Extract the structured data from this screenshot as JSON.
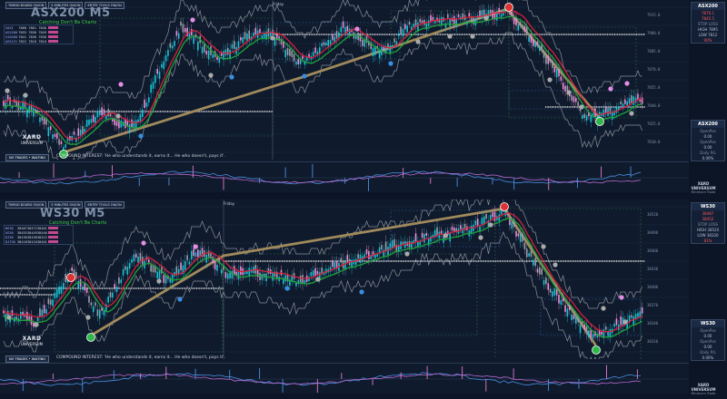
{
  "colors": {
    "bg": "#0f1a2c",
    "candle_up": "#19c2d6",
    "candle_down": "#ec8fd6",
    "ma_red": "#d2213d",
    "ma_green": "#1fa33a",
    "trend": "#a08a5c",
    "band": "#8a8f99"
  },
  "top_buttons": [
    "TIMING BOARD ON/ON",
    "5 MINUTES ON/ON",
    "ENTRY TOOLS ON/ON"
  ],
  "panel1": {
    "symbol": "ASX200 M5",
    "subtitle": "Catching Don't Be Charts",
    "day_label": "Friday",
    "table": [
      {
        "label": "SA5I",
        "a": "7880",
        "b": "7861",
        "c": "7846"
      },
      {
        "label": "ASX200",
        "a": "7855",
        "b": "7850",
        "c": "7849"
      },
      {
        "label": "XJO200",
        "a": "7841",
        "b": "7836",
        "c": "7830"
      },
      {
        "label": "AS51Z1",
        "a": "7822",
        "b": "7818",
        "c": "7810"
      }
    ],
    "compound": "COMPOUND INTEREST: 'He who understands it, earns it... He who doesn't, pays it'.",
    "nt_button": "NO TRADES • WAITING",
    "logo_name": "XARD",
    "logo_sub": "UNIVERSUM",
    "axis": [
      "7915.0",
      "7900.0",
      "7885.0",
      "7870.0",
      "7855.0",
      "7840.0",
      "7825.0",
      "7810.0"
    ],
    "side": {
      "top_box": {
        "title": "ASX200",
        "rows": [
          "7870.1",
          "7845.5",
          "STOP LOSS",
          "HIGH 7895",
          "LOW 7812",
          "90%"
        ]
      },
      "bottom_box": {
        "title": "ASX200",
        "rows": [
          "OpenPos",
          "0.00",
          "OpenPos",
          "0.00",
          "Daily P/L",
          "0.00%"
        ]
      }
    },
    "footer": {
      "name": "XARD UNIVERSUM",
      "sub": "Minimum Trade"
    }
  },
  "panel2": {
    "symbol": "WS30 M5",
    "subtitle": "Catching Don't Be Charts",
    "day_label": "Friday",
    "table": [
      {
        "label": "WS30",
        "a": "38487",
        "b": "38472",
        "c": "38461"
      },
      {
        "label": "US30",
        "a": "38455",
        "b": "38449",
        "c": "38440"
      },
      {
        "label": "DJ30",
        "a": "38436",
        "b": "38430",
        "c": "38422"
      },
      {
        "label": "DJI30",
        "a": "38418",
        "b": "38410",
        "c": "38401"
      }
    ],
    "compound": "COMPOUND INTEREST: 'He who understands it, earns it... He who doesn't, pays it'.",
    "nt_button": "NO TRADES • WAITING",
    "logo_name": "XARD",
    "logo_sub": "UNIVERSUM",
    "axis": [
      "38520",
      "38490",
      "38460",
      "38430",
      "38400",
      "38370",
      "38340",
      "38310"
    ],
    "side": {
      "top_box": {
        "title": "WS30",
        "rows": [
          "38487",
          "38452",
          "STOP LOSS",
          "HIGH 38520",
          "LOW 38320",
          "81%"
        ]
      },
      "bottom_box": {
        "title": "WS30",
        "rows": [
          "OpenPos",
          "0.00",
          "OpenPos",
          "0.00",
          "Daily P/L",
          "0.00%"
        ]
      }
    },
    "footer": {
      "name": "XARD UNIVERSUM",
      "sub": "Minimum Trade"
    }
  }
}
